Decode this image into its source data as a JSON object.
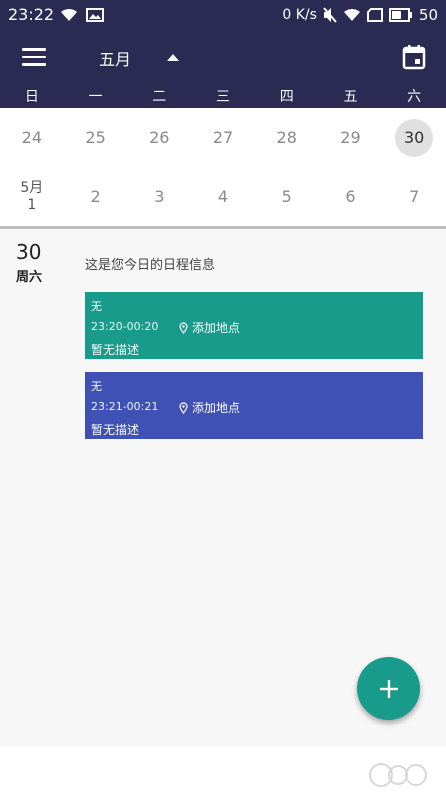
{
  "status_bar": {
    "time": "23:22",
    "data_speed": "0 K/s",
    "battery": "50"
  },
  "app_bar": {
    "month_title": "五月",
    "icons": [
      "menu-icon",
      "caret-up-icon",
      "calendar-icon"
    ]
  },
  "weekdays": [
    "日",
    "一",
    "二",
    "三",
    "四",
    "五",
    "六"
  ],
  "calendar": {
    "row1": [
      "24",
      "25",
      "26",
      "27",
      "28",
      "29",
      "30"
    ],
    "row2": {
      "first_month_label": "5月",
      "first_day": "1",
      "rest": [
        "2",
        "3",
        "4",
        "5",
        "6",
        "7"
      ]
    },
    "selected": "30"
  },
  "agenda": {
    "date_number": "30",
    "weekday": "周六",
    "message": "这是您今日的日程信息"
  },
  "events": [
    {
      "title": "无",
      "time": "23:20-00:20",
      "location": "添加地点",
      "description": "暂无描述",
      "color": "#189b8a"
    },
    {
      "title": "无",
      "time": "23:21-00:21",
      "location": "添加地点",
      "description": "暂无描述",
      "color": "#3f51b5"
    }
  ],
  "fab": {
    "icon": "plus-icon",
    "label": "+"
  },
  "colors": {
    "header": "#2b2a52",
    "accent": "#189b8a",
    "event2": "#3f51b5"
  }
}
